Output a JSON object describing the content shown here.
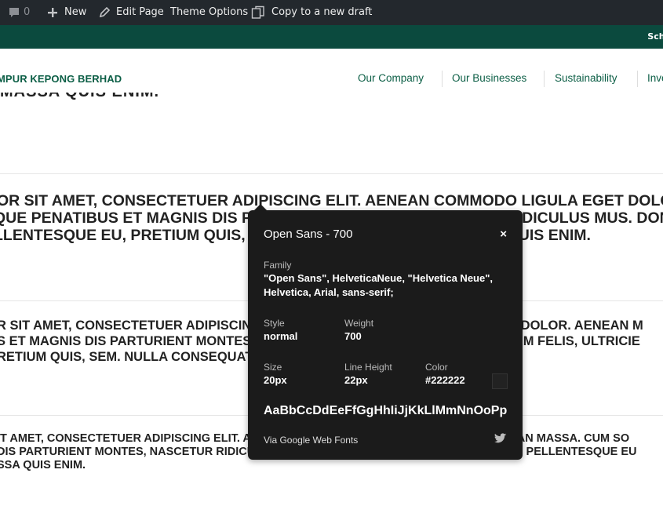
{
  "admin_bar": {
    "comments_count": "0",
    "new_label": "New",
    "edit_label": "Edit Page",
    "theme_label": "Theme Options",
    "copy_label": "Copy to a new draft"
  },
  "top_strip": {
    "text": "Sche"
  },
  "header": {
    "brand": "MPUR KEPONG BERHAD",
    "nav": [
      "Our Company",
      "Our Businesses",
      "Sustainability",
      "Inve"
    ]
  },
  "content": {
    "clipped_heading": "MASSA QUIS ENIM.",
    "block1": [
      "OR SIT AMET, CONSECTETUER ADIPISCING ELIT. AENEAN COMMODO LIGULA EGET DOLOR",
      "QUE PENATIBUS ET MAGNIS DIS PARTURIENT MONTES, NASCETUR RIDICULUS MUS. DONE",
      "LLENTESQUE EU, PRETIUM QUIS, SEM. NULLA CONSEQUAT MASSA QUIS ENIM."
    ],
    "block2": [
      "R SIT AMET, CONSECTETUER ADIPISCING ELIT. AENEAN COMMODO LIGULA EGET DOLOR. AENEAN M",
      "S ET MAGNIS DIS PARTURIENT MONTES, NASCETUR RIDICULUS MUS. DONEC QUAM FELIS, ULTRICIE",
      "RETIUM QUIS, SEM. NULLA CONSEQUAT MASSA QUIS ENIM."
    ],
    "block3": [
      "IT AMET, CONSECTETUER ADIPISCING ELIT. AENEAN COMMODO LIGULA EGET DOLOR. AENEAN MASSA. CUM SO",
      "DIS PARTURIENT MONTES, NASCETUR RIDICULUS MUS. DONEC QUAM FELIS, ULTRICIES NEC, PELLENTESQUE EU",
      "SSA QUIS ENIM."
    ]
  },
  "popup": {
    "title": "Open Sans - 700",
    "close": "×",
    "family_label": "Family",
    "family_value": "\"Open Sans\", HelveticaNeue, \"Helvetica Neue\", Helvetica, Arial, sans-serif;",
    "style_label": "Style",
    "style_value": "normal",
    "weight_label": "Weight",
    "weight_value": "700",
    "size_label": "Size",
    "size_value": "20px",
    "lineheight_label": "Line Height",
    "lineheight_value": "22px",
    "color_label": "Color",
    "color_value": "#222222",
    "sample": "AaBbCcDdEeFfGgHhIiJjKkLlMmNnOoPpQqRrSsTtUuVvWwXxYyZz",
    "via": "Via Google Web Fonts",
    "colors": {
      "bg": "#1b1b1b",
      "swatch": "#222222"
    }
  },
  "colors": {
    "admin_bar": "#23282d",
    "brand_green": "#0b5e45",
    "strip": "#0b4a3e"
  }
}
